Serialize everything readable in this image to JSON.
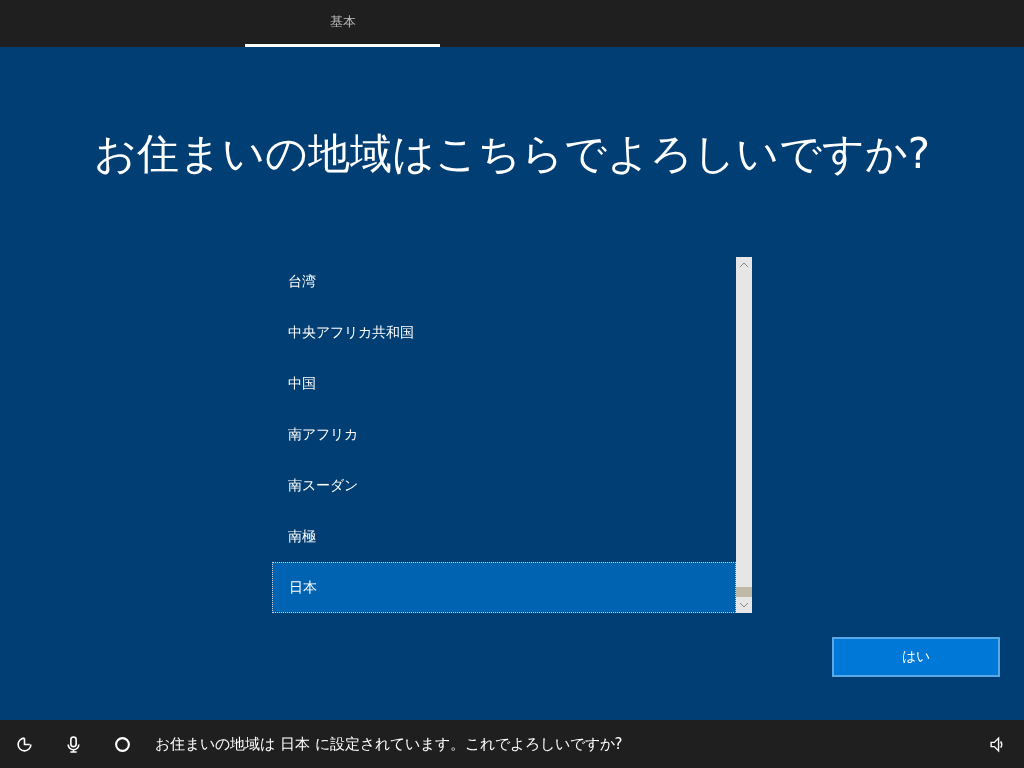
{
  "tabs": [
    {
      "label": "基本",
      "selected": true
    }
  ],
  "title": "お住まいの地域はこちらでよろしいですか?",
  "regions": [
    {
      "label": "台湾",
      "selected": false
    },
    {
      "label": "中央アフリカ共和国",
      "selected": false
    },
    {
      "label": "中国",
      "selected": false
    },
    {
      "label": "南アフリカ",
      "selected": false
    },
    {
      "label": "南スーダン",
      "selected": false
    },
    {
      "label": "南極",
      "selected": false
    },
    {
      "label": "日本",
      "selected": true
    }
  ],
  "confirm_button": "はい",
  "status_bar": {
    "message": "お住まいの地域は 日本 に設定されています。これでよろしいですか?"
  }
}
